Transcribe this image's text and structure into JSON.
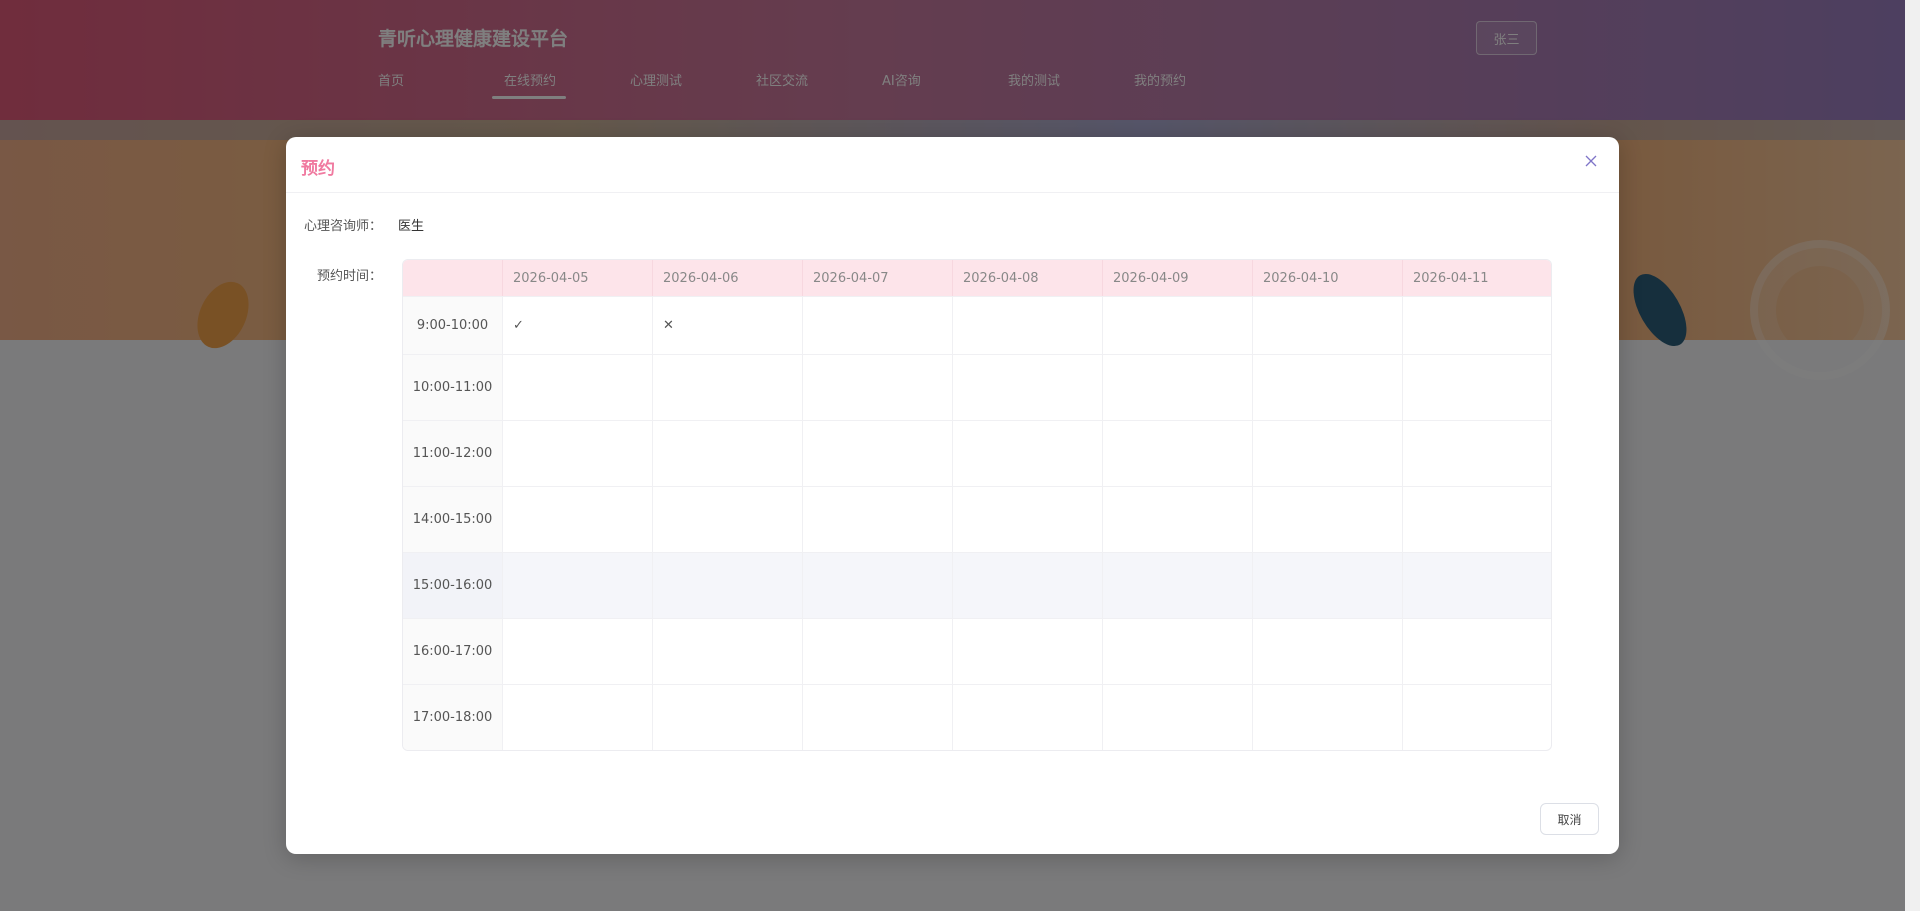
{
  "header": {
    "brand": "青听心理健康建设平台",
    "nav": [
      "首页",
      "在线预约",
      "心理测试",
      "社区交流",
      "AI咨询",
      "我的测试",
      "我的预约"
    ],
    "active_nav": "在线预约",
    "user": "张三"
  },
  "dialog": {
    "title": "预约",
    "counselor_label": "心理咨询师：",
    "counselor_value": "医生",
    "time_label": "预约时间：",
    "dates": [
      "2026-04-05",
      "2026-04-06",
      "2026-04-07",
      "2026-04-08",
      "2026-04-09",
      "2026-04-10",
      "2026-04-11"
    ],
    "slots": [
      {
        "time": "9:00-10:00",
        "cells": [
          "✓",
          "✕",
          "",
          "",
          "",
          "",
          ""
        ]
      },
      {
        "time": "10:00-11:00",
        "cells": [
          "",
          "",
          "",
          "",
          "",
          "",
          ""
        ]
      },
      {
        "time": "11:00-12:00",
        "cells": [
          "",
          "",
          "",
          "",
          "",
          "",
          ""
        ]
      },
      {
        "time": "14:00-15:00",
        "cells": [
          "",
          "",
          "",
          "",
          "",
          "",
          ""
        ]
      },
      {
        "time": "15:00-16:00",
        "cells": [
          "",
          "",
          "",
          "",
          "",
          "",
          ""
        ]
      },
      {
        "time": "16:00-17:00",
        "cells": [
          "",
          "",
          "",
          "",
          "",
          "",
          ""
        ]
      },
      {
        "time": "17:00-18:00",
        "cells": [
          "",
          "",
          "",
          "",
          "",
          "",
          ""
        ]
      }
    ],
    "highlighted_slot": "15:00-16:00",
    "cancel_label": "取消",
    "close_icon": "close-icon"
  },
  "colors": {
    "title": "#f07aa0",
    "table_header_bg": "#fde4ea",
    "close_icon": "#7f74c8"
  }
}
